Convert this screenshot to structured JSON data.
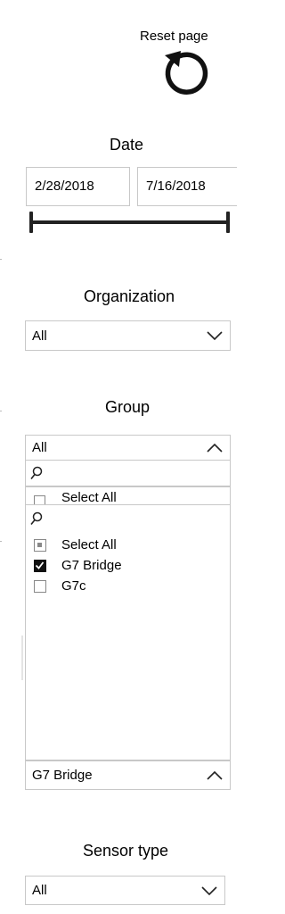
{
  "reset": {
    "label": "Reset page",
    "icon": "reset-icon"
  },
  "date": {
    "heading": "Date",
    "start": "2/28/2018",
    "end": "7/16/2018",
    "range_fraction": [
      0,
      1
    ]
  },
  "organization": {
    "heading": "Organization",
    "selected": "All",
    "icon": "chevron-down-icon"
  },
  "group": {
    "heading": "Group",
    "selected": "All",
    "icon": "chevron-up-icon",
    "select_all_peek": "Select All",
    "items": [
      {
        "label": "Select All",
        "state": "partial"
      },
      {
        "label": "G7 Bridge",
        "state": "checked"
      },
      {
        "label": "G7c",
        "state": "unchecked"
      }
    ],
    "selection_value": "G7 Bridge"
  },
  "sensor_type": {
    "heading": "Sensor type",
    "selected": "All",
    "icon": "chevron-down-icon"
  },
  "colors": {
    "border": "#c8c8c8",
    "text": "#000000",
    "slider": "#222222"
  }
}
